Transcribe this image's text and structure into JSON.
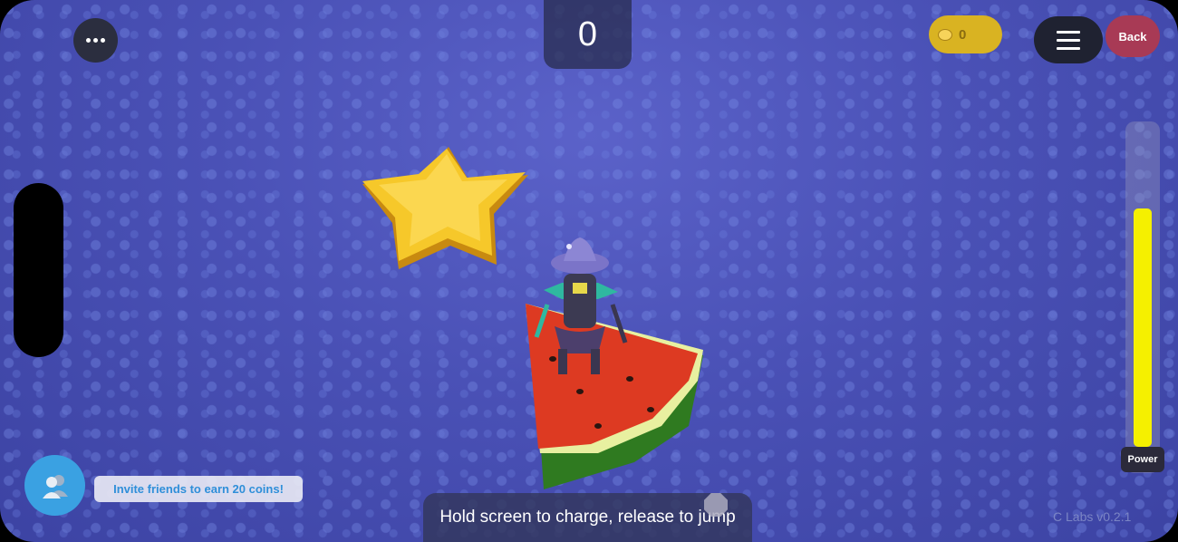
{
  "hud": {
    "score": "0",
    "coins": "0",
    "back_label": "Back",
    "power_label": "Power",
    "power_level": 0.75,
    "power_color": "#f5f000"
  },
  "social": {
    "invite_text": "Invite friends to earn 20 coins!"
  },
  "hint": {
    "text": "Hold screen to charge, release to jump"
  },
  "version": "C Labs v0.2.1",
  "icons": {
    "more": "more-dots-icon",
    "menu": "hamburger-menu-icon",
    "coin": "coin-icon",
    "invite": "friends-icon"
  },
  "scene": {
    "floor_color": "#4a51b6",
    "objects": [
      "star-platform",
      "watermelon-platform",
      "witch-character"
    ]
  }
}
